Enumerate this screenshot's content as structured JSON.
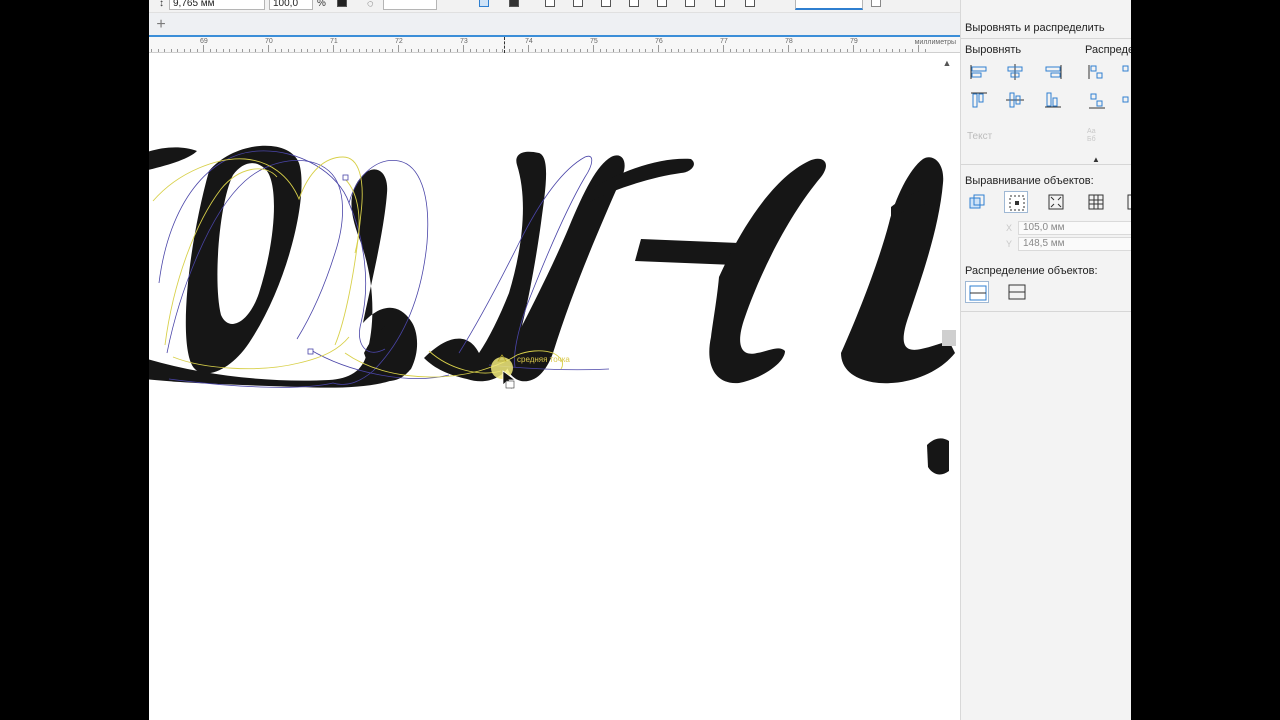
{
  "property_bar": {
    "height_value": "9,765 мм",
    "scale_value": "100,0",
    "percent_unit": "%"
  },
  "ruler": {
    "labels": [
      "69",
      "70",
      "71",
      "72",
      "73",
      "74",
      "75",
      "76",
      "77",
      "78",
      "79"
    ],
    "unit": "миллиметры"
  },
  "canvas": {
    "snap_label": "средняя точка",
    "artwork_icon": "script-lettering-curves"
  },
  "docker": {
    "title": "Выровнять и распределить",
    "align_label": "Выровнять",
    "distribute_label": "Распреде",
    "text_label": "Текст",
    "align_objects_label": "Выравнивание объектов:",
    "x_value": "105,0 мм",
    "y_value": "148,5 мм",
    "x_axis_label": "X",
    "y_axis_label": "Y",
    "distribute_objects_label": "Распределение объектов:",
    "text_icon_label_top": "Аа",
    "text_icon_label_bottom": "Бб"
  },
  "colors": {
    "accent": "#3b8ed8",
    "icon_blue": "#2f7fd0",
    "glyph_fill": "#161616",
    "outline_blue": "#4a45a8",
    "outline_yellow": "#d8d04a"
  }
}
